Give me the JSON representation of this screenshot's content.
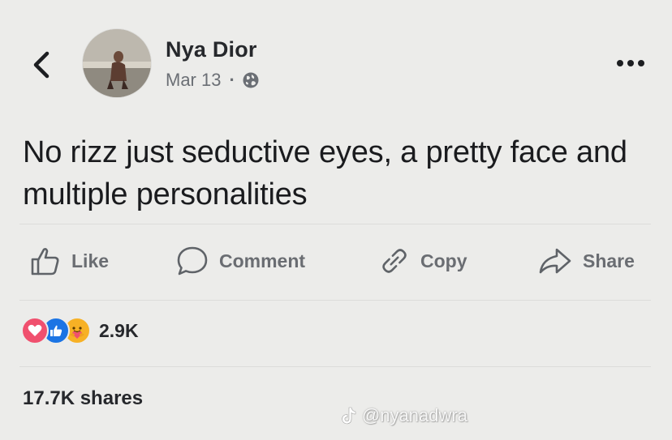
{
  "post": {
    "author_name": "Nya Dior",
    "date": "Mar 13",
    "separator": "·",
    "visibility_icon": "globe-icon",
    "text": "No rizz just seductive eyes, a pretty face and multiple personalities"
  },
  "actions": {
    "like": "Like",
    "comment": "Comment",
    "copy": "Copy",
    "share": "Share"
  },
  "reactions": {
    "icons": [
      "love-icon",
      "like-icon",
      "care-icon"
    ],
    "count": "2.9K"
  },
  "shares": "17.7K shares",
  "watermark": {
    "platform_icon": "tiktok-logo",
    "handle": "@nyanadwra"
  },
  "colors": {
    "background": "#ececea",
    "muted_text": "#6a6d72",
    "love": "#f0506e",
    "like": "#1b74e4",
    "care": "#f7b125"
  }
}
